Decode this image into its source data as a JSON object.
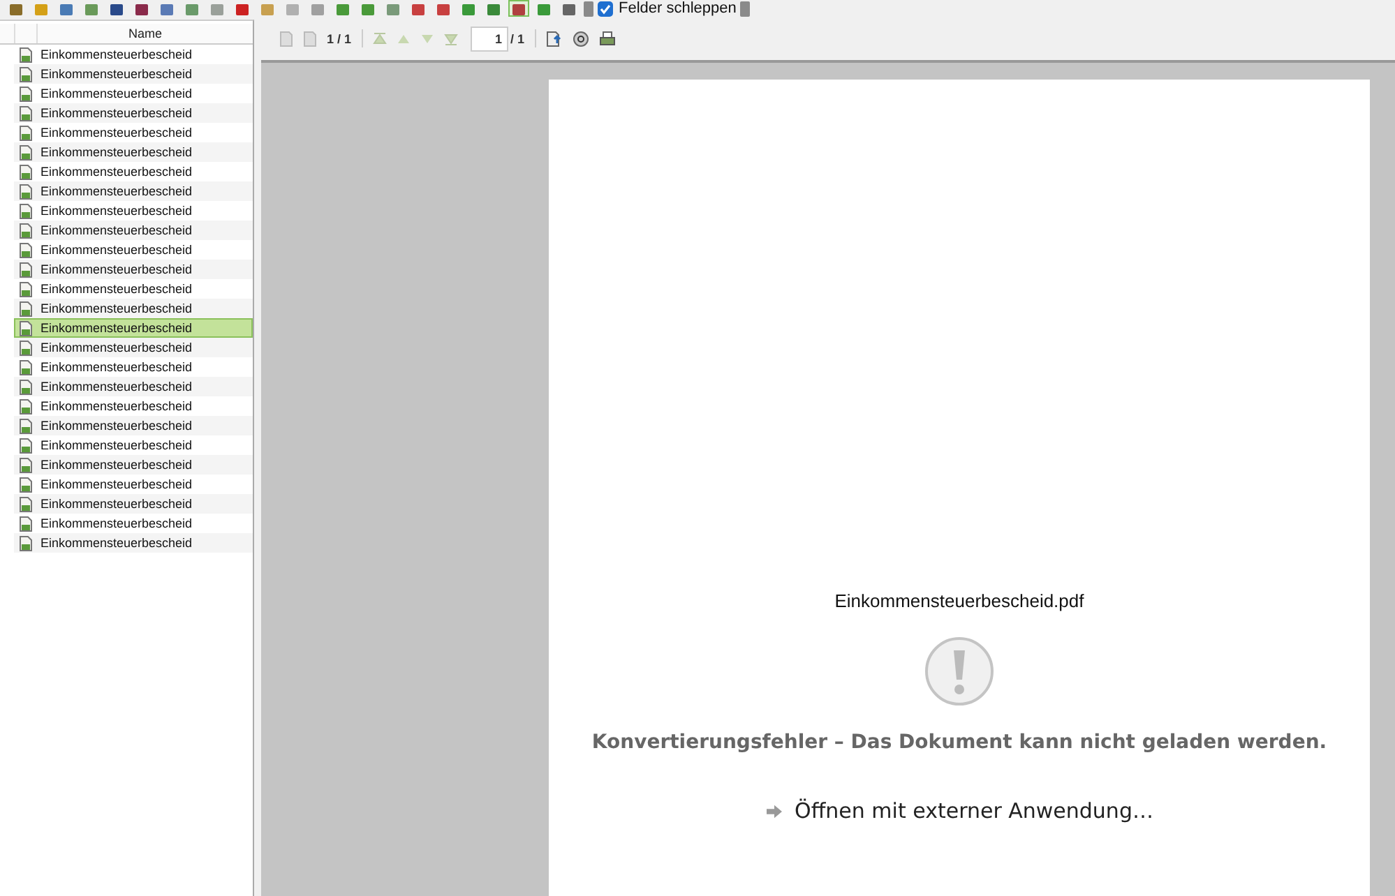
{
  "toolbar": {
    "buttons": [
      {
        "pressed": false
      },
      {
        "pressed": false
      },
      {
        "pressed": false
      },
      {
        "pressed": false
      },
      {
        "pressed": false
      },
      {
        "pressed": false
      },
      {
        "pressed": false
      },
      {
        "pressed": false
      },
      {
        "pressed": false
      },
      {
        "pressed": false
      },
      {
        "pressed": false
      },
      {
        "pressed": false
      },
      {
        "pressed": false
      },
      {
        "pressed": false
      },
      {
        "pressed": false
      },
      {
        "pressed": false
      },
      {
        "pressed": false
      },
      {
        "pressed": false
      },
      {
        "pressed": false
      },
      {
        "pressed": false
      },
      {
        "pressed": true
      },
      {
        "pressed": false
      },
      {
        "pressed": false
      }
    ],
    "drag_fields": {
      "label": "Felder schleppen",
      "checked": true
    }
  },
  "list": {
    "column": "Name",
    "rows": [
      {
        "name": "Einkommensteuerbescheid",
        "selected": false
      },
      {
        "name": "Einkommensteuerbescheid",
        "selected": false
      },
      {
        "name": "Einkommensteuerbescheid",
        "selected": false
      },
      {
        "name": "Einkommensteuerbescheid",
        "selected": false
      },
      {
        "name": "Einkommensteuerbescheid",
        "selected": false
      },
      {
        "name": "Einkommensteuerbescheid",
        "selected": false
      },
      {
        "name": "Einkommensteuerbescheid",
        "selected": false
      },
      {
        "name": "Einkommensteuerbescheid",
        "selected": false
      },
      {
        "name": "Einkommensteuerbescheid",
        "selected": false
      },
      {
        "name": "Einkommensteuerbescheid",
        "selected": false
      },
      {
        "name": "Einkommensteuerbescheid",
        "selected": false
      },
      {
        "name": "Einkommensteuerbescheid",
        "selected": false
      },
      {
        "name": "Einkommensteuerbescheid",
        "selected": false
      },
      {
        "name": "Einkommensteuerbescheid",
        "selected": false
      },
      {
        "name": "Einkommensteuerbescheid",
        "selected": true
      },
      {
        "name": "Einkommensteuerbescheid",
        "selected": false
      },
      {
        "name": "Einkommensteuerbescheid",
        "selected": false
      },
      {
        "name": "Einkommensteuerbescheid",
        "selected": false
      },
      {
        "name": "Einkommensteuerbescheid",
        "selected": false
      },
      {
        "name": "Einkommensteuerbescheid",
        "selected": false
      },
      {
        "name": "Einkommensteuerbescheid",
        "selected": false
      },
      {
        "name": "Einkommensteuerbescheid",
        "selected": false
      },
      {
        "name": "Einkommensteuerbescheid",
        "selected": false
      },
      {
        "name": "Einkommensteuerbescheid",
        "selected": false
      },
      {
        "name": "Einkommensteuerbescheid",
        "selected": false
      },
      {
        "name": "Einkommensteuerbescheid",
        "selected": false
      }
    ]
  },
  "pager": {
    "page_count": "1 / 1",
    "page_field": "1",
    "page_total": "/ 1"
  },
  "document": {
    "filename": "Einkommensteuerbescheid.pdf",
    "error": "Konvertierungsfehler – Das Dokument kann nicht geladen werden.",
    "open_link": "Öffnen mit externer Anwendung…"
  }
}
